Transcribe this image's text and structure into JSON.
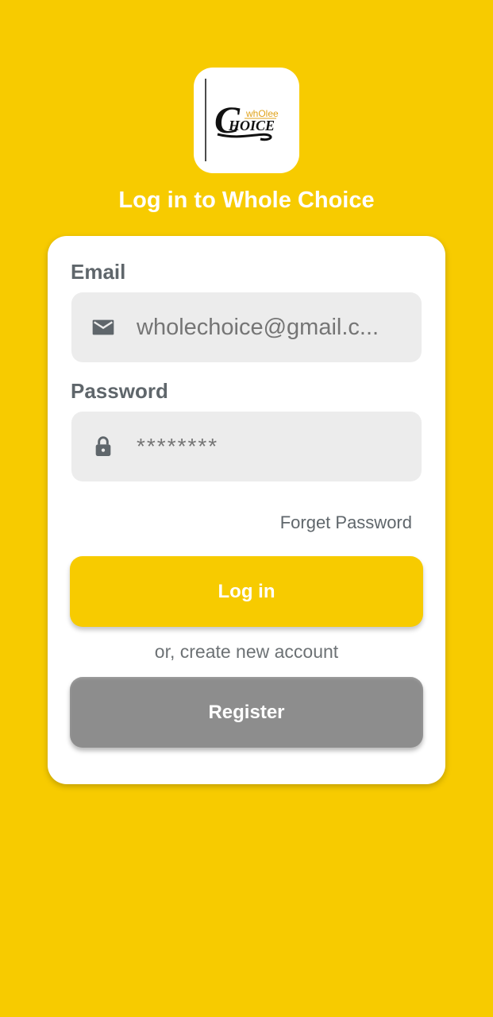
{
  "logo": {
    "icon": "whole-choice-logo",
    "small_text": "whOlee",
    "big_text": "HOICE",
    "initial": "C"
  },
  "page": {
    "title": "Log in to Whole Choice"
  },
  "form": {
    "email": {
      "label": "Email",
      "placeholder": "wholechoice@gmail.c...",
      "icon": "envelope-icon"
    },
    "password": {
      "label": "Password",
      "placeholder": "********",
      "icon": "lock-icon"
    },
    "forget_password": "Forget Password",
    "login_label": "Log in",
    "or_text": "or, create new account",
    "register_label": "Register"
  },
  "colors": {
    "background": "#F7CB00",
    "accent": "#F7CB00",
    "card": "#FFFFFF",
    "register_button": "#8D8D8D",
    "label_text": "#5F666B"
  }
}
